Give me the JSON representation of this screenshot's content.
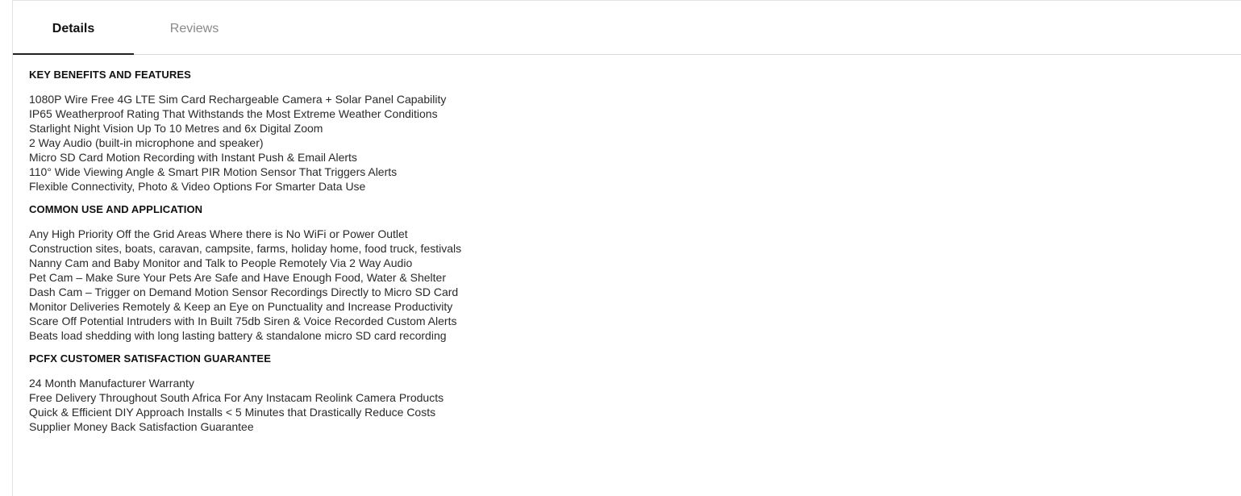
{
  "tabs": {
    "details": "Details",
    "reviews": "Reviews"
  },
  "sections": [
    {
      "title": "KEY BENEFITS AND FEATURES",
      "lines": [
        "1080P Wire Free 4G LTE Sim Card Rechargeable Camera + Solar Panel Capability",
        "IP65 Weatherproof Rating That Withstands the Most Extreme Weather Conditions",
        "Starlight Night Vision Up To 10 Metres and 6x Digital Zoom",
        "2 Way Audio (built-in microphone and speaker)",
        "Micro SD Card Motion Recording with Instant Push & Email Alerts",
        "110° Wide Viewing Angle & Smart PIR Motion Sensor That Triggers Alerts",
        "Flexible Connectivity, Photo & Video Options For Smarter Data Use"
      ]
    },
    {
      "title": "COMMON USE AND APPLICATION",
      "lines": [
        "Any High Priority Off the Grid Areas Where there is No WiFi or Power Outlet",
        "Construction sites, boats, caravan, campsite, farms, holiday home, food truck, festivals",
        "Nanny Cam and Baby Monitor and Talk to People Remotely Via 2 Way Audio",
        "Pet Cam – Make Sure Your Pets Are Safe and Have Enough Food, Water & Shelter",
        "Dash Cam – Trigger on Demand Motion Sensor Recordings Directly to Micro SD Card",
        "Monitor Deliveries Remotely & Keep an Eye on Punctuality and Increase Productivity",
        "Scare Off Potential Intruders with In Built 75db Siren & Voice Recorded Custom Alerts",
        "Beats load shedding with long lasting battery & standalone micro SD card recording"
      ]
    },
    {
      "title": "PCFX CUSTOMER SATISFACTION GUARANTEE",
      "lines": [
        "24 Month Manufacturer Warranty",
        "Free Delivery Throughout South Africa For Any Instacam Reolink Camera Products",
        "Quick & Efficient DIY Approach Installs < 5 Minutes that Drastically Reduce Costs",
        "Supplier Money Back Satisfaction Guarantee"
      ]
    }
  ]
}
